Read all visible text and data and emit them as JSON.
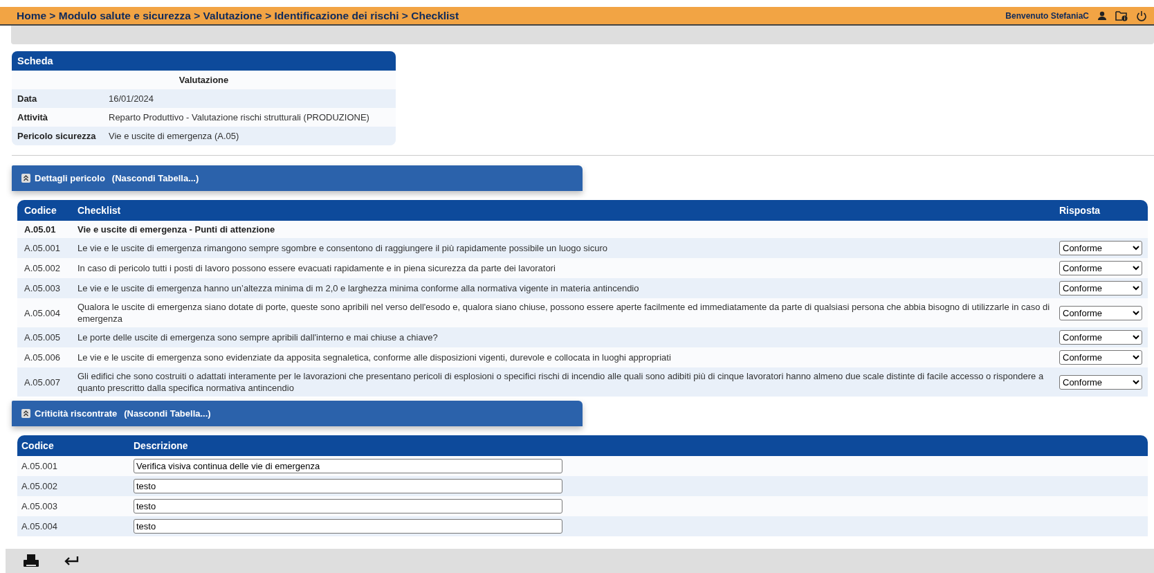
{
  "header": {
    "breadcrumb": "Home > Modulo salute e sicurezza > Valutazione > Identificazione dei rischi > Checklist",
    "greeting": "Benvenuto StefaniaC"
  },
  "scheda": {
    "title": "Scheda",
    "subtitle": "Valutazione",
    "fields": [
      {
        "label": "Data",
        "value": "16/01/2024"
      },
      {
        "label": "Attività",
        "value": "Reparto Produttivo - Valutazione rischi strutturali (PRODUZIONE)"
      },
      {
        "label": "Pericolo sicurezza",
        "value": "Vie e uscite di emergenza (A.05)"
      }
    ]
  },
  "dettagli": {
    "title": "Dettagli pericolo",
    "toggle": "(Nascondi Tabella...)",
    "expanded": true,
    "columns": [
      "Codice",
      "Checklist",
      "Risposta"
    ],
    "group": {
      "code": "A.05.01",
      "title": "Vie e uscite di emergenza - Punti di attenzione"
    },
    "rows": [
      {
        "code": "A.05.001",
        "text": "Le vie e le uscite di emergenza rimangono sempre sgombre e consentono di raggiungere il più rapidamente possibile un luogo sicuro",
        "answer": "Conforme"
      },
      {
        "code": "A.05.002",
        "text": "In caso di pericolo tutti i posti di lavoro possono essere evacuati rapidamente e in piena sicurezza da parte dei lavoratori",
        "answer": "Conforme"
      },
      {
        "code": "A.05.003",
        "text": "Le vie e le uscite di emergenza hanno un’altezza minima di m 2,0 e larghezza minima conforme alla normativa vigente in materia antincendio",
        "answer": "Conforme"
      },
      {
        "code": "A.05.004",
        "text": "Qualora le uscite di emergenza siano dotate di porte, queste sono apribili nel verso dell'esodo e, qualora siano chiuse, possono essere aperte facilmente ed immediatamente da parte di qualsiasi persona che abbia bisogno di utilizzarle in caso di emergenza",
        "answer": "Conforme"
      },
      {
        "code": "A.05.005",
        "text": "Le porte delle uscite di emergenza sono sempre apribili dall'interno e mai chiuse a chiave?",
        "answer": "Conforme"
      },
      {
        "code": "A.05.006",
        "text": "Le vie e le uscite di emergenza sono evidenziate da apposita segnaletica, conforme alle disposizioni vigenti, durevole e collocata in luoghi appropriati",
        "answer": "Conforme"
      },
      {
        "code": "A.05.007",
        "text": "Gli edifici che sono costruiti o adattati interamente per le lavorazioni che presentano pericoli di esplosioni o specifici rischi di incendio alle quali sono adibiti più di cinque lavoratori hanno almeno due scale distinte di facile accesso o rispondere a quanto prescritto dalla specifica normativa antincendio",
        "answer": "Conforme"
      }
    ]
  },
  "criticita": {
    "title": "Criticità riscontrate",
    "toggle": "(Nascondi Tabella...)",
    "expanded": true,
    "columns": [
      "Codice",
      "Descrizione"
    ],
    "rows": [
      {
        "code": "A.05.001",
        "value": "Verifica visiva continua delle vie di emergenza"
      },
      {
        "code": "A.05.002",
        "value": "testo"
      },
      {
        "code": "A.05.003",
        "value": "testo"
      },
      {
        "code": "A.05.004",
        "value": "testo"
      }
    ]
  }
}
